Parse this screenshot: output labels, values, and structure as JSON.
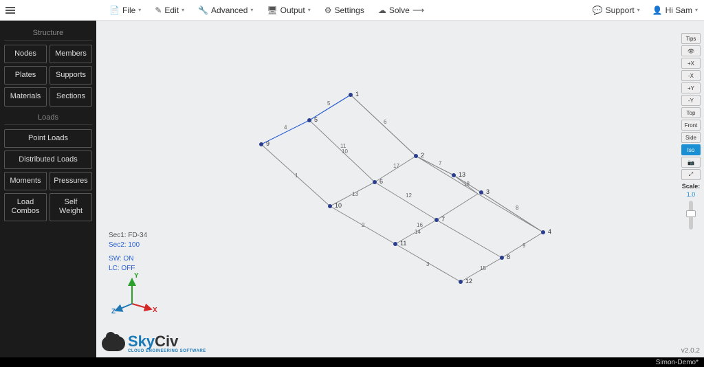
{
  "top": {
    "file": "File",
    "edit": "Edit",
    "advanced": "Advanced",
    "output": "Output",
    "settings": "Settings",
    "solve": "Solve",
    "support": "Support",
    "greeting": "Hi Sam"
  },
  "left": {
    "structure_title": "Structure",
    "nodes": "Nodes",
    "members": "Members",
    "plates": "Plates",
    "supports": "Supports",
    "materials": "Materials",
    "sections": "Sections",
    "loads_title": "Loads",
    "point_loads": "Point Loads",
    "dist_loads": "Distributed Loads",
    "moments": "Moments",
    "pressures": "Pressures",
    "load_combos": "Load Combos",
    "self_weight": "Self Weight"
  },
  "canvas": {
    "sec1": "Sec1: FD-34",
    "sec2": "Sec2: 100",
    "sw": "SW: ON",
    "lc": "LC: OFF",
    "axes": {
      "x": "X",
      "y": "Y",
      "z": "Z"
    },
    "logo_main": "SkyCiv",
    "logo_sub": "CLOUD ENGINEERING SOFTWARE",
    "version": "v2.0.2",
    "node_labels": [
      "1",
      "2",
      "3",
      "4",
      "5",
      "6",
      "7",
      "8",
      "9",
      "10",
      "11",
      "12",
      "13"
    ],
    "edge_labels": {
      "e1": "1",
      "e2": "2",
      "e3": "3",
      "e4": "4",
      "e5": "5",
      "e6": "6",
      "e7": "7",
      "e8": "8",
      "e9": "9",
      "e10": "10",
      "e11": "11",
      "e12": "12",
      "e13": "13",
      "e14": "14",
      "e15": "15",
      "e16": "16",
      "e17": "17",
      "e18": "18"
    }
  },
  "right": {
    "tips": "Tips",
    "px": "+X",
    "mx": "-X",
    "py": "+Y",
    "my": "-Y",
    "top": "Top",
    "front": "Front",
    "side": "Side",
    "iso": "Iso",
    "scale_label": "Scale:",
    "scale_val": "1.0"
  },
  "footer": {
    "filename": "Simon-Demo*"
  }
}
